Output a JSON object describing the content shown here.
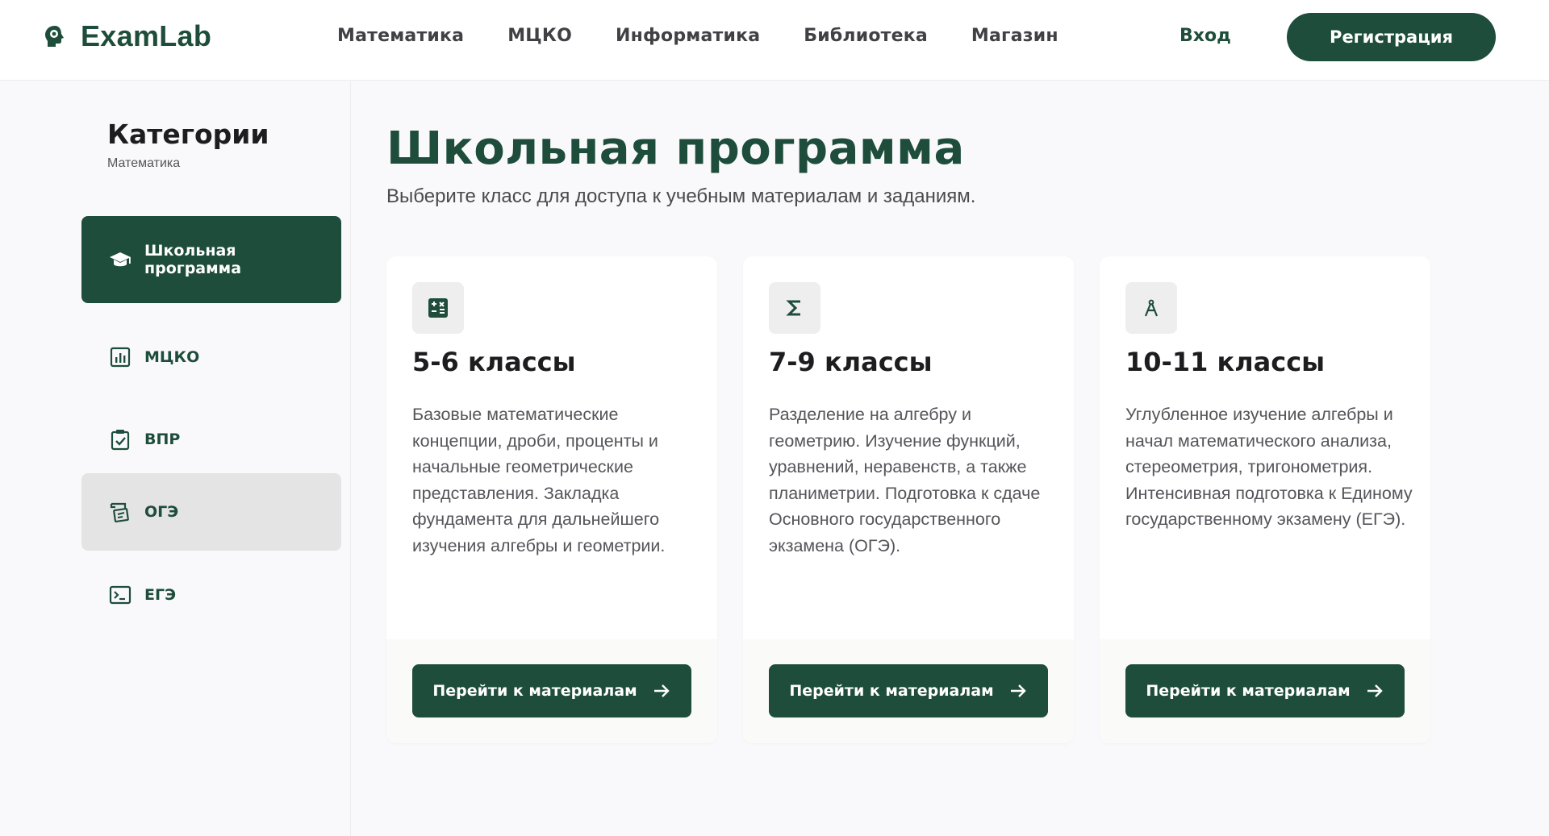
{
  "brand": {
    "name": "ExamLab",
    "accent": "#1e4d3b"
  },
  "nav": {
    "items": [
      "Математика",
      "МЦКО",
      "Информатика",
      "Библиотека",
      "Магазин"
    ],
    "login": "Вход",
    "register": "Регистрация"
  },
  "sidebar": {
    "title": "Категории",
    "subtitle": "Математика",
    "items": [
      {
        "label": "Школьная программа",
        "icon": "graduation-cap-icon",
        "state": "active"
      },
      {
        "label": "МЦКО",
        "icon": "bar-chart-icon",
        "state": "default"
      },
      {
        "label": "ВПР",
        "icon": "clipboard-check-icon",
        "state": "default"
      },
      {
        "label": "ОГЭ",
        "icon": "school-exam-icon",
        "state": "hover"
      },
      {
        "label": "ЕГЭ",
        "icon": "terminal-icon",
        "state": "default"
      }
    ]
  },
  "main": {
    "title": "Школьная программа",
    "subtitle": "Выберите класс для доступа к учебным материалам и заданиям.",
    "cards": [
      {
        "icon": "calculator-icon",
        "title": "5-6 классы",
        "text": "Базовые математические концепции, дроби, проценты и начальные геометрические представления. Закладка фундамента для дальнейшего изучения алгебры и геометрии.",
        "button": "Перейти к материалам"
      },
      {
        "icon": "sigma-icon",
        "title": "7-9 классы",
        "text": "Разделение на алгебру и геометрию. Изучение функций, уравнений, неравенств, а также планиметрии. Подготовка к сдаче Основного государственного экзамена (ОГЭ).",
        "button": "Перейти к материалам"
      },
      {
        "icon": "compass-icon",
        "title": "10-11 классы",
        "text": "Углубленное изучение алгебры и начал математического анализа, стереометрия, тригонометрия. Интенсивная подготовка к Единому государственному экзамену (ЕГЭ).",
        "button": "Перейти к материалам"
      }
    ]
  }
}
